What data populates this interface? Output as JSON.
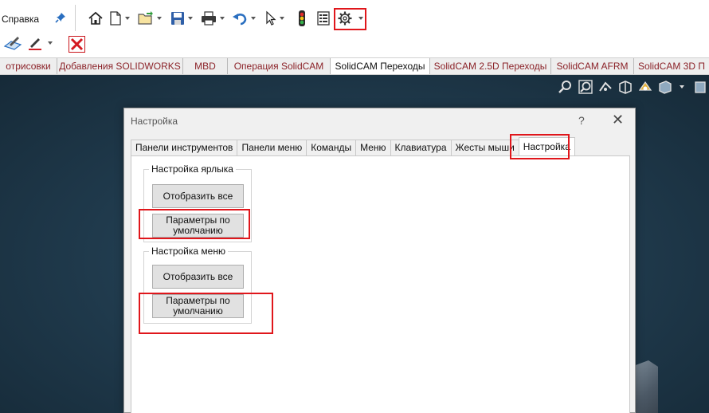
{
  "menu": {
    "help": "Справка"
  },
  "command_tabs": [
    {
      "label": "отрисовки",
      "active": false
    },
    {
      "label": "Добавления SOLIDWORKS",
      "active": false
    },
    {
      "label": "MBD",
      "active": false
    },
    {
      "label": "Операция  SolidCAM",
      "active": false
    },
    {
      "label": "SolidCAM Переходы",
      "active": true
    },
    {
      "label": "SolidCAM 2.5D Переходы",
      "active": false
    },
    {
      "label": "SolidCAM AFRM",
      "active": false
    },
    {
      "label": "SolidCAM 3D П",
      "active": false
    }
  ],
  "dialog": {
    "title": "Настройка",
    "help": "?",
    "close": "✕",
    "tabs": [
      {
        "label": "Панели инструментов"
      },
      {
        "label": "Панели меню"
      },
      {
        "label": "Команды"
      },
      {
        "label": "Меню"
      },
      {
        "label": "Клавиатура"
      },
      {
        "label": "Жесты мыши"
      },
      {
        "label": "Настройка"
      }
    ],
    "shortcut_group": {
      "title": "Настройка ярлыка",
      "show_all": "Отобразить все",
      "defaults": "Параметры по умолчанию"
    },
    "menu_group": {
      "title": "Настройка меню",
      "show_all": "Отобразить все",
      "defaults": "Параметры по умолчанию"
    }
  },
  "colors": {
    "highlight": "#e0161b",
    "tab_text": "#8b2228",
    "viewport": "#1f3a4d"
  }
}
